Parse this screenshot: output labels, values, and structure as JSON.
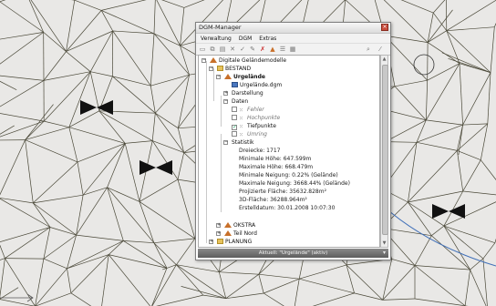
{
  "colors": {
    "background": "#e9e8e6",
    "mesh": "#4a4838",
    "accent_line": "#3f6fb8",
    "window_title_bg": "#e6e6e6",
    "statusbar_bg": "#6b6b6b"
  },
  "window": {
    "title": "DGM-Manager",
    "menu": [
      "Verwaltung",
      "DGM",
      "Extras"
    ]
  },
  "toolbar": {
    "icons": [
      "new-icon",
      "copy-icon",
      "paste-icon",
      "delete-icon",
      "check-icon",
      "edit-icon",
      "remove-icon",
      "mountain-icon",
      "list-icon",
      "properties-icon",
      "zoom-icon",
      "brush-icon"
    ]
  },
  "tree": {
    "root": "Digitale Geländemodelle",
    "bestand": "BESTAND",
    "urgelaende": "Urgelände",
    "file": "Urgelände.dgm",
    "darstellung": "Darstellung",
    "daten": "Daten",
    "daten_items": [
      {
        "label": "Fehler",
        "checked": false
      },
      {
        "label": "Hochpunkte",
        "checked": false
      },
      {
        "label": "Tiefpunkte",
        "checked": true
      },
      {
        "label": "Umring",
        "checked": false
      }
    ],
    "statistik": "Statistik",
    "stats": [
      "Dreiecke: 1717",
      "Minimale Höhe: 647.599m",
      "Maximale Höhe: 668.479m",
      "Minimale Neigung: 0.22% (Gelände)",
      "Maximale Neigung: 3668.44% (Gelände)",
      "Projizierte Fläche: 35632.828m²",
      "3D-Fläche: 36288.964m²",
      "Erstelldatum: 30.01.2008 10:07:30"
    ],
    "okstra": "OKSTRA",
    "teil_nord": "Teil Nord",
    "planung": "PLANUNG"
  },
  "statusbar": {
    "text": "Aktuell: \"Urgelände\" (aktiv)"
  }
}
